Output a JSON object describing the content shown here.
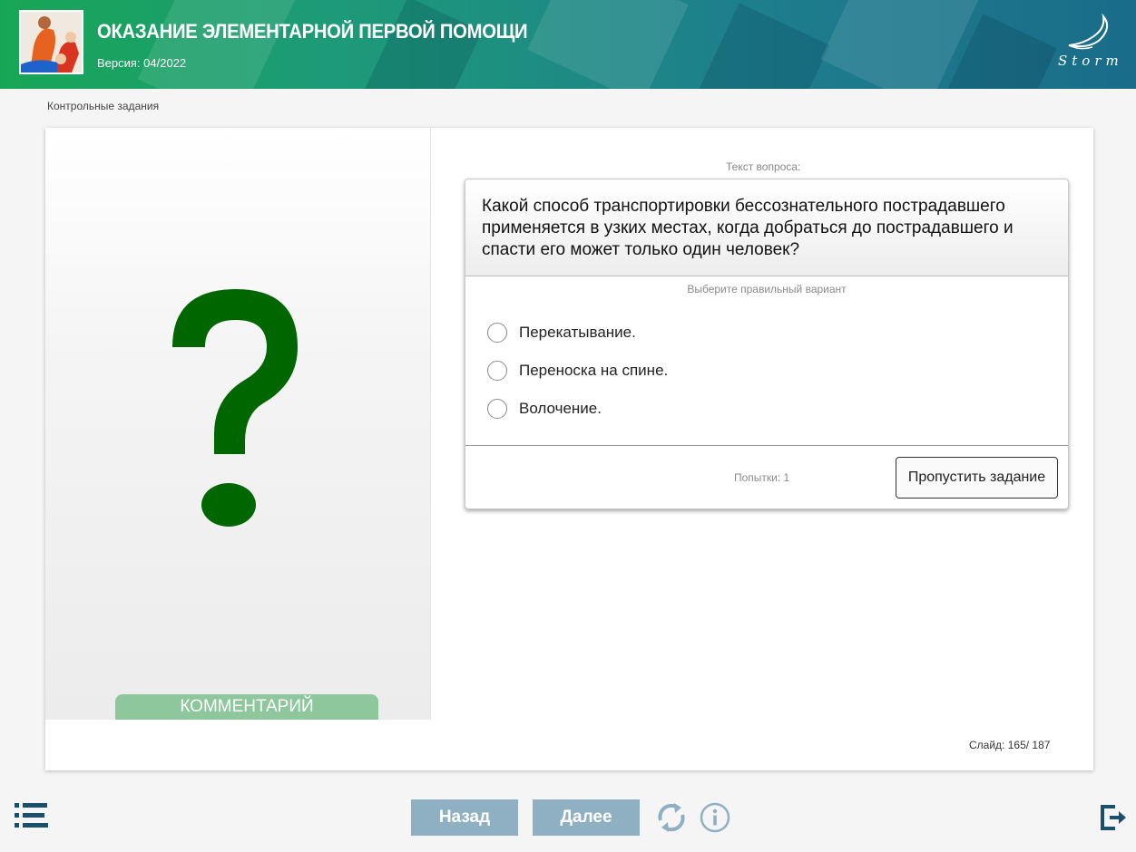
{
  "header": {
    "title": "ОКАЗАНИЕ ЭЛЕМЕНТАРНОЙ ПЕРВОЙ ПОМОЩИ",
    "version": "Версия: 04/2022",
    "logo_text": "Storm",
    "thumbnail_icon": "first-aid-illustration"
  },
  "breadcrumb": "Контрольные задания",
  "left_pane": {
    "illustration_icon": "question-mark-icon",
    "comment_tab_label": "КОММЕНТАРИЙ"
  },
  "question": {
    "caption": "Текст вопроса:",
    "text": "Какой способ транспортировки бессознательного пострадавшего применяется в узких местах, когда добраться до пострадавшего и спасти его может только один человек?",
    "hint": "Выберите правильный вариант",
    "options": [
      {
        "label": "Перекатывание.",
        "selected": false
      },
      {
        "label": "Переноска на спине.",
        "selected": false
      },
      {
        "label": "Волочение.",
        "selected": false
      }
    ],
    "attempts": "Попытки: 1",
    "skip_label": "Пропустить задание"
  },
  "slide_counter": "Слайд:  165/ 187",
  "toolbar": {
    "back_label": "Назад",
    "next_label": "Далее",
    "icons": [
      "menu-icon",
      "refresh-icon",
      "info-icon",
      "exit-icon"
    ]
  },
  "colors": {
    "header_green": "#18a656",
    "header_teal": "#1a6c8a",
    "question_mark": "#006600",
    "comment_tab": "#8dc79b",
    "nav_button": "#8fafc3",
    "toolbar_icon": "#1b4f6e"
  }
}
